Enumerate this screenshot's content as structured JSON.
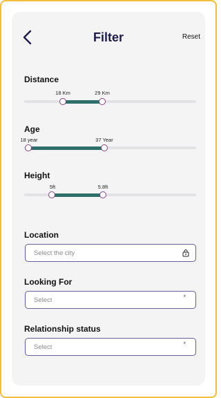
{
  "header": {
    "title": "Filter",
    "reset_label": "Reset",
    "back_icon": "chevron-left-icon"
  },
  "sliders": {
    "distance": {
      "label": "Distance",
      "min_label": "18 Km",
      "max_label": "29 Km"
    },
    "age": {
      "label": "Age",
      "min_label": "18 year",
      "max_label": "37 Year"
    },
    "height": {
      "label": "Height",
      "min_label": "5ft",
      "max_label": "5.8ft"
    }
  },
  "location": {
    "label": "Location",
    "placeholder": "Select the city",
    "icon": "lock-icon"
  },
  "looking_for": {
    "label": "Looking For",
    "placeholder": "Select",
    "marker": "*"
  },
  "relationship": {
    "label": "Relationship status",
    "placeholder": "Select",
    "marker": "*"
  },
  "colors": {
    "title": "#1E1B4B",
    "accent_fill": "#2F6F6A",
    "thumb_border": "#8A3F86",
    "frame": "#F2BE3B"
  }
}
